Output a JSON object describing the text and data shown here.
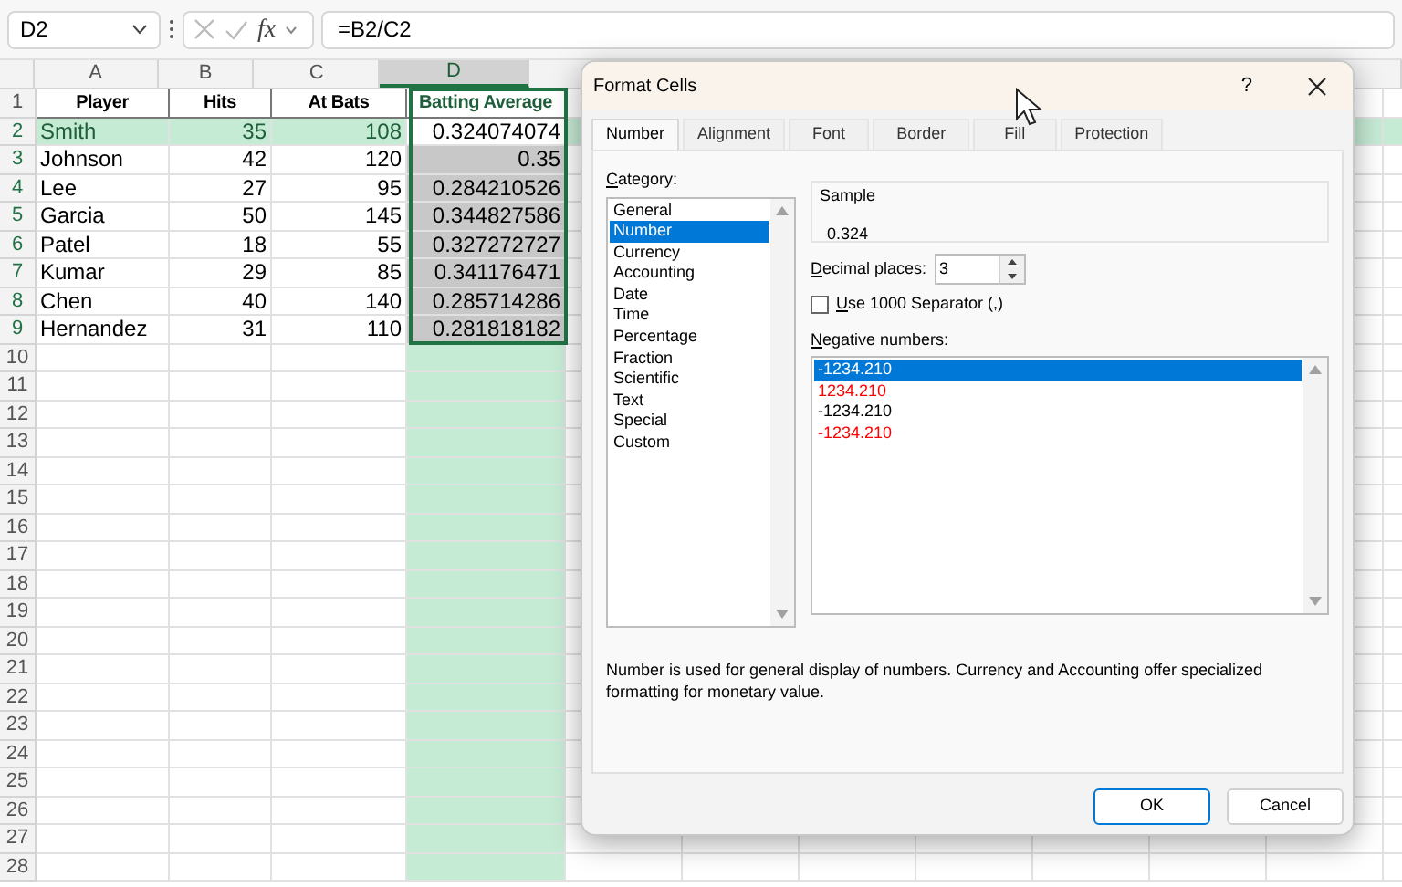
{
  "name_box": "D2",
  "fx_label": "fx",
  "formula": "=B2/C2",
  "columns": [
    {
      "label": "A",
      "selected": false
    },
    {
      "label": "B",
      "selected": false
    },
    {
      "label": "C",
      "selected": false
    },
    {
      "label": "D",
      "selected": true
    }
  ],
  "rows": [
    {
      "number": "1",
      "cells": [
        "Player",
        "Hits",
        "At Bats",
        "Batting Average"
      ],
      "selected": false,
      "active": false
    },
    {
      "number": "2",
      "cells": [
        "Smith",
        "35",
        "108",
        "0.324074074"
      ],
      "selected": true,
      "active": true
    },
    {
      "number": "3",
      "cells": [
        "Johnson",
        "42",
        "120",
        "0.35"
      ],
      "selected": true,
      "active": false
    },
    {
      "number": "4",
      "cells": [
        "Lee",
        "27",
        "95",
        "0.284210526"
      ],
      "selected": true,
      "active": false
    },
    {
      "number": "5",
      "cells": [
        "Garcia",
        "50",
        "145",
        "0.344827586"
      ],
      "selected": true,
      "active": false
    },
    {
      "number": "6",
      "cells": [
        "Patel",
        "18",
        "55",
        "0.327272727"
      ],
      "selected": true,
      "active": false
    },
    {
      "number": "7",
      "cells": [
        "Kumar",
        "29",
        "85",
        "0.341176471"
      ],
      "selected": true,
      "active": false
    },
    {
      "number": "8",
      "cells": [
        "Chen",
        "40",
        "140",
        "0.285714286"
      ],
      "selected": true,
      "active": false
    },
    {
      "number": "9",
      "cells": [
        "Hernandez",
        "31",
        "110",
        "0.281818182"
      ],
      "selected": true,
      "active": false
    },
    {
      "number": "10",
      "selected": false,
      "active": false
    },
    {
      "number": "11",
      "selected": false,
      "active": false
    },
    {
      "number": "12",
      "selected": false,
      "active": false
    },
    {
      "number": "13",
      "selected": false,
      "active": false
    },
    {
      "number": "14",
      "selected": false,
      "active": false
    },
    {
      "number": "15",
      "selected": false,
      "active": false
    },
    {
      "number": "16",
      "selected": false,
      "active": false
    },
    {
      "number": "17",
      "selected": false,
      "active": false
    },
    {
      "number": "18",
      "selected": false,
      "active": false
    },
    {
      "number": "19",
      "selected": false,
      "active": false
    },
    {
      "number": "20",
      "selected": false,
      "active": false
    },
    {
      "number": "21",
      "selected": false,
      "active": false
    },
    {
      "number": "22",
      "selected": false,
      "active": false
    },
    {
      "number": "23",
      "selected": false,
      "active": false
    },
    {
      "number": "24",
      "selected": false,
      "active": false
    },
    {
      "number": "25",
      "selected": false,
      "active": false
    },
    {
      "number": "26",
      "selected": false,
      "active": false
    },
    {
      "number": "27",
      "selected": false,
      "active": false
    },
    {
      "number": "28",
      "selected": false,
      "active": false
    }
  ],
  "dialog": {
    "title": "Format Cells",
    "help": "?",
    "tabs": [
      {
        "label": "Number",
        "selected": true
      },
      {
        "label": "Alignment",
        "selected": false
      },
      {
        "label": "Font",
        "selected": false
      },
      {
        "label": "Border",
        "selected": false
      },
      {
        "label": "Fill",
        "selected": false
      },
      {
        "label": "Protection",
        "selected": false
      }
    ],
    "category_label": "Category:",
    "categories": [
      {
        "label": "General",
        "selected": false
      },
      {
        "label": "Number",
        "selected": true
      },
      {
        "label": "Currency",
        "selected": false
      },
      {
        "label": "Accounting",
        "selected": false
      },
      {
        "label": "Date",
        "selected": false
      },
      {
        "label": "Time",
        "selected": false
      },
      {
        "label": "Percentage",
        "selected": false
      },
      {
        "label": "Fraction",
        "selected": false
      },
      {
        "label": "Scientific",
        "selected": false
      },
      {
        "label": "Text",
        "selected": false
      },
      {
        "label": "Special",
        "selected": false
      },
      {
        "label": "Custom",
        "selected": false
      }
    ],
    "sample_label": "Sample",
    "sample_value": "0.324",
    "decimal_label": "Decimal places:",
    "decimal_value": "3",
    "separator": {
      "label": "Use 1000 Separator (,)",
      "checked": false
    },
    "negative_label": "Negative numbers:",
    "negatives": [
      {
        "label": "-1234.210",
        "selected": true
      },
      {
        "label": "1234.210",
        "color": "#ff0000",
        "selected": false
      },
      {
        "label": "-1234.210",
        "color": "#000000",
        "selected": false
      },
      {
        "label": "-1234.210",
        "color": "#ff0000",
        "selected": false
      }
    ],
    "description": "Number is used for general display of numbers.  Currency and Accounting offer specialized formatting for monetary value.",
    "buttons": [
      {
        "label": "OK",
        "kind": "default"
      },
      {
        "label": "Cancel",
        "kind": "normal"
      }
    ]
  }
}
